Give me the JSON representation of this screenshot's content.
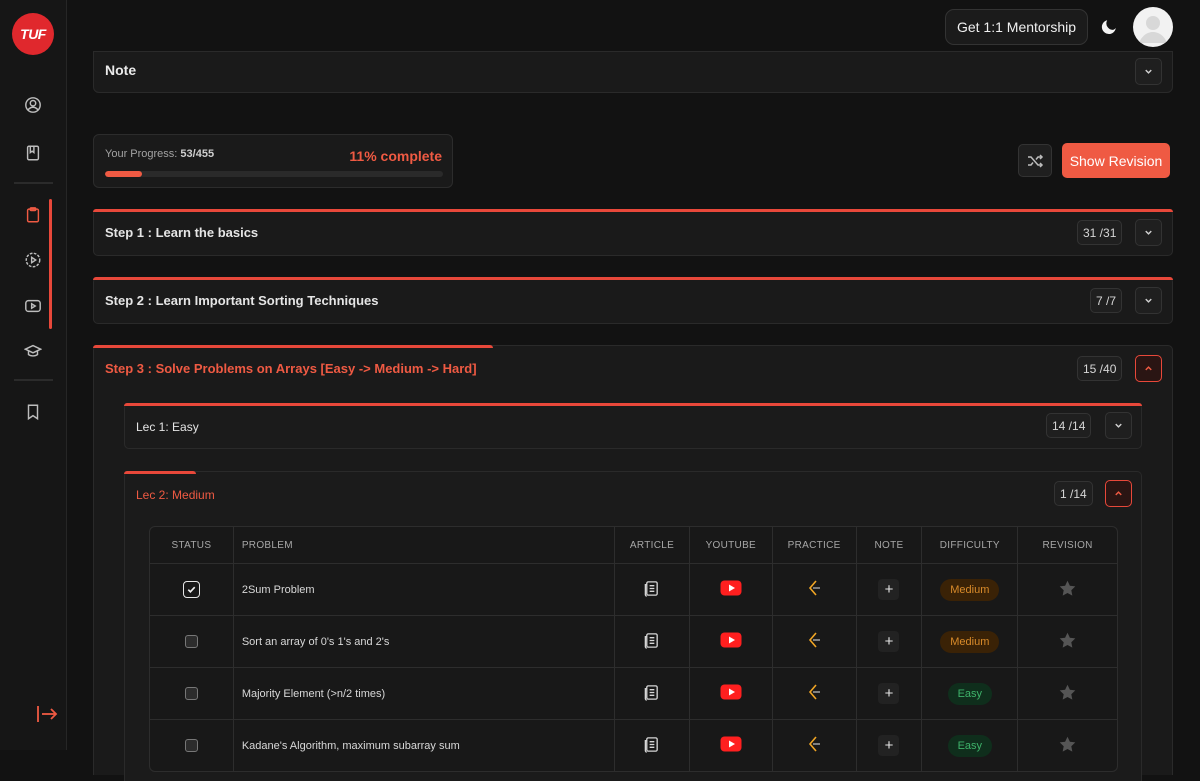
{
  "brand": {
    "logo_text": "TUF",
    "accent": "#ef5a43"
  },
  "header": {
    "mentorship_label": "Get 1:1 Mentorship",
    "theme_icon": "moon-icon"
  },
  "note_section": {
    "title": "Note"
  },
  "progress": {
    "label": "Your Progress: ",
    "value": "53/455",
    "percent_label": "11% complete",
    "percent": 11
  },
  "actions": {
    "revision_label": "Show Revision"
  },
  "steps": [
    {
      "title": "Step 1 : Learn the basics",
      "count": "31 /31"
    },
    {
      "title": "Step 2 : Learn Important Sorting Techniques",
      "count": "7 /7"
    },
    {
      "title": "Step 3 : Solve Problems on Arrays [Easy -> Medium -> Hard]",
      "count": "15 /40"
    }
  ],
  "lectures": [
    {
      "title": "Lec 1: Easy",
      "count": "14 /14"
    },
    {
      "title": "Lec 2: Medium",
      "count": "1 /14"
    }
  ],
  "table": {
    "headers": [
      "STATUS",
      "PROBLEM",
      "ARTICLE",
      "YOUTUBE",
      "PRACTICE",
      "NOTE",
      "DIFFICULTY",
      "REVISION"
    ],
    "rows": [
      {
        "done": true,
        "problem": "2Sum Problem",
        "difficulty": "Medium"
      },
      {
        "done": false,
        "problem": "Sort an array of 0's 1's and 2's",
        "difficulty": "Medium"
      },
      {
        "done": false,
        "problem": "Majority Element (>n/2 times)",
        "difficulty": "Easy"
      },
      {
        "done": false,
        "problem": "Kadane's Algorithm, maximum subarray sum",
        "difficulty": "Easy"
      }
    ]
  }
}
